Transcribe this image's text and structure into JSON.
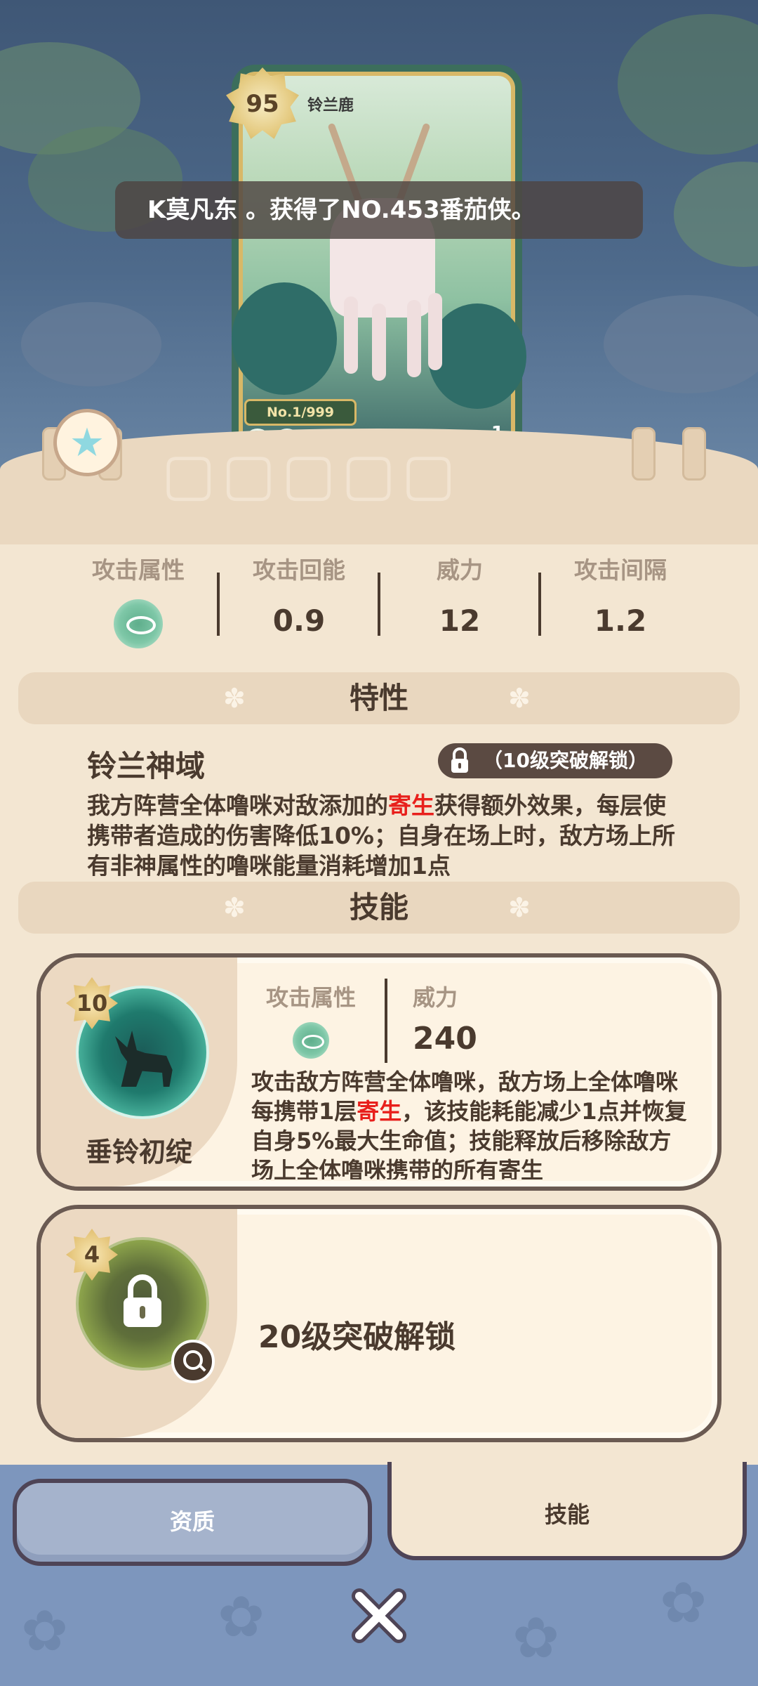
{
  "card": {
    "level": "95",
    "name": "铃兰鹿",
    "serial": "No.1/999",
    "count": "1"
  },
  "toast": {
    "text": "K莫凡东 。获得了NO.453番茄侠。"
  },
  "stats": [
    {
      "label": "攻击属性",
      "value": "",
      "icon": "attribute-icon"
    },
    {
      "label": "攻击回能",
      "value": "0.9"
    },
    {
      "label": "威力",
      "value": "12"
    },
    {
      "label": "攻击间隔",
      "value": "1.2"
    }
  ],
  "trait": {
    "section_title": "特性",
    "name": "铃兰神域",
    "lock_label": "（10级突破解锁）",
    "desc_part1": "我方阵营全体噜咪对敌添加的",
    "desc_highlight": "寄生",
    "desc_part2": "获得额外效果，每层使携带者造成的伤害降低10%；自身在场上时，敌方场上所有非神属性的噜咪能量消耗增加1点"
  },
  "skills": {
    "section_title": "技能",
    "items": [
      {
        "level": "10",
        "name": "垂铃初绽",
        "attr_label": "攻击属性",
        "power_label": "威力",
        "power_value": "240",
        "desc_part1": "攻击敌方阵营全体噜咪，敌方场上全体噜咪每携带1层",
        "desc_highlight": "寄生",
        "desc_part2": "，该技能耗能减少1点并恢复自身5%最大生命值；技能释放后移除敌方场上全体噜咪携带的所有寄生"
      },
      {
        "level": "4",
        "unlock_text": "20级突破解锁"
      }
    ]
  },
  "tabs": {
    "left": "资质",
    "right": "技能"
  },
  "colors": {
    "highlight": "#e8201c",
    "panel": "#f3e6d2",
    "dark": "#4a3a2e"
  }
}
